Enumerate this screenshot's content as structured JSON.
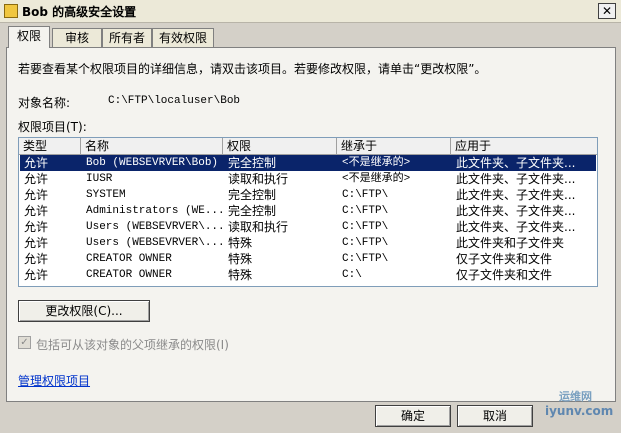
{
  "window": {
    "title": "Bob 的高级安全设置",
    "close_glyph": "✕"
  },
  "tabs": [
    "权限",
    "审核",
    "所有者",
    "有效权限"
  ],
  "instructions": "若要查看某个权限项目的详细信息，请双击该项目。若要修改权限，请单击“更改权限”。",
  "object": {
    "label": "对象名称:",
    "value": "C:\\FTP\\localuser\\Bob"
  },
  "entries_label": "权限项目(T):",
  "columns": [
    "类型",
    "名称",
    "权限",
    "继承于",
    "应用于"
  ],
  "rows": [
    {
      "type": "允许",
      "name": "Bob (WEBSEVRVER\\Bob)",
      "perm": "完全控制",
      "inherit": "<不是继承的>",
      "apply": "此文件夹、子文件夹..."
    },
    {
      "type": "允许",
      "name": "IUSR",
      "perm": "读取和执行",
      "inherit": "<不是继承的>",
      "apply": "此文件夹、子文件夹..."
    },
    {
      "type": "允许",
      "name": "SYSTEM",
      "perm": "完全控制",
      "inherit": "C:\\FTP\\",
      "apply": "此文件夹、子文件夹..."
    },
    {
      "type": "允许",
      "name": "Administrators (WE...",
      "perm": "完全控制",
      "inherit": "C:\\FTP\\",
      "apply": "此文件夹、子文件夹..."
    },
    {
      "type": "允许",
      "name": "Users (WEBSEVRVER\\...",
      "perm": "读取和执行",
      "inherit": "C:\\FTP\\",
      "apply": "此文件夹、子文件夹..."
    },
    {
      "type": "允许",
      "name": "Users (WEBSEVRVER\\...",
      "perm": "特殊",
      "inherit": "C:\\FTP\\",
      "apply": "此文件夹和子文件夹"
    },
    {
      "type": "允许",
      "name": "CREATOR OWNER",
      "perm": "特殊",
      "inherit": "C:\\FTP\\",
      "apply": "仅子文件夹和文件"
    },
    {
      "type": "允许",
      "name": "CREATOR OWNER",
      "perm": "特殊",
      "inherit": "C:\\",
      "apply": "仅子文件夹和文件"
    }
  ],
  "change_button": "更改权限(C)...",
  "inherit_checkbox": {
    "label": "包括可从该对象的父项继承的权限(I)",
    "checked": true
  },
  "manage_link": "管理权限项目",
  "footer": {
    "ok": "确定",
    "cancel": "取消"
  },
  "watermark": {
    "line1": "运维网",
    "line2": "iyunv.com"
  },
  "colors": {
    "selected_row": "#0a246a",
    "link": "#0033cc"
  }
}
